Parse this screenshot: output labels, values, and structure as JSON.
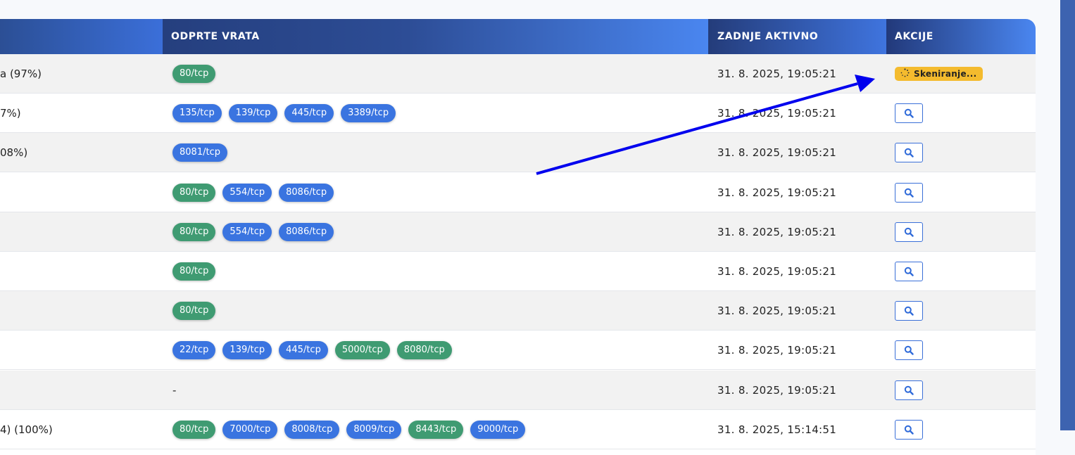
{
  "table": {
    "columns": {
      "ports": "ODPRTE VRATA",
      "last_active": "ZADNJE AKTIVNO",
      "actions": "AKCIJE"
    },
    "rows": [
      {
        "host": "a (97%)",
        "ports": [
          {
            "label": "80/tcp",
            "color": "green"
          }
        ],
        "last_active": "31. 8. 2025, 19:05:21",
        "action": "scanning"
      },
      {
        "host": "7%)",
        "ports": [
          {
            "label": "135/tcp",
            "color": "blue"
          },
          {
            "label": "139/tcp",
            "color": "blue"
          },
          {
            "label": "445/tcp",
            "color": "blue"
          },
          {
            "label": "3389/tcp",
            "color": "blue"
          }
        ],
        "last_active": "31. 8. 2025, 19:05:21",
        "action": "search"
      },
      {
        "host": "08%)",
        "ports": [
          {
            "label": "8081/tcp",
            "color": "blue"
          }
        ],
        "last_active": "31. 8. 2025, 19:05:21",
        "action": "search"
      },
      {
        "host": "",
        "ports": [
          {
            "label": "80/tcp",
            "color": "green"
          },
          {
            "label": "554/tcp",
            "color": "blue"
          },
          {
            "label": "8086/tcp",
            "color": "blue"
          }
        ],
        "last_active": "31. 8. 2025, 19:05:21",
        "action": "search"
      },
      {
        "host": "",
        "ports": [
          {
            "label": "80/tcp",
            "color": "green"
          },
          {
            "label": "554/tcp",
            "color": "blue"
          },
          {
            "label": "8086/tcp",
            "color": "blue"
          }
        ],
        "last_active": "31. 8. 2025, 19:05:21",
        "action": "search"
      },
      {
        "host": "",
        "ports": [
          {
            "label": "80/tcp",
            "color": "green"
          }
        ],
        "last_active": "31. 8. 2025, 19:05:21",
        "action": "search"
      },
      {
        "host": "",
        "ports": [
          {
            "label": "80/tcp",
            "color": "green"
          }
        ],
        "last_active": "31. 8. 2025, 19:05:21",
        "action": "search"
      },
      {
        "host": "",
        "ports": [
          {
            "label": "22/tcp",
            "color": "blue"
          },
          {
            "label": "139/tcp",
            "color": "blue"
          },
          {
            "label": "445/tcp",
            "color": "blue"
          },
          {
            "label": "5000/tcp",
            "color": "green"
          },
          {
            "label": "8080/tcp",
            "color": "green"
          }
        ],
        "last_active": "31. 8. 2025, 19:05:21",
        "action": "search"
      },
      {
        "host": "",
        "ports": [],
        "empty_text": "-",
        "last_active": "31. 8. 2025, 19:05:21",
        "action": "search"
      },
      {
        "host": "4) (100%)",
        "ports": [
          {
            "label": "80/tcp",
            "color": "green"
          },
          {
            "label": "7000/tcp",
            "color": "blue"
          },
          {
            "label": "8008/tcp",
            "color": "blue"
          },
          {
            "label": "8009/tcp",
            "color": "blue"
          },
          {
            "label": "8443/tcp",
            "color": "green"
          },
          {
            "label": "9000/tcp",
            "color": "blue"
          }
        ],
        "last_active": "31. 8. 2025, 15:14:51",
        "action": "search"
      }
    ],
    "scanning_label": "Skeniranje..."
  },
  "colors": {
    "green_port": "#3f9b72",
    "blue_port": "#3a74e0",
    "scan_badge": "#f4bb2e",
    "annotation_arrow": "#0000ee"
  },
  "icons": {
    "search": "search-icon",
    "spinner": "spinner-icon"
  }
}
